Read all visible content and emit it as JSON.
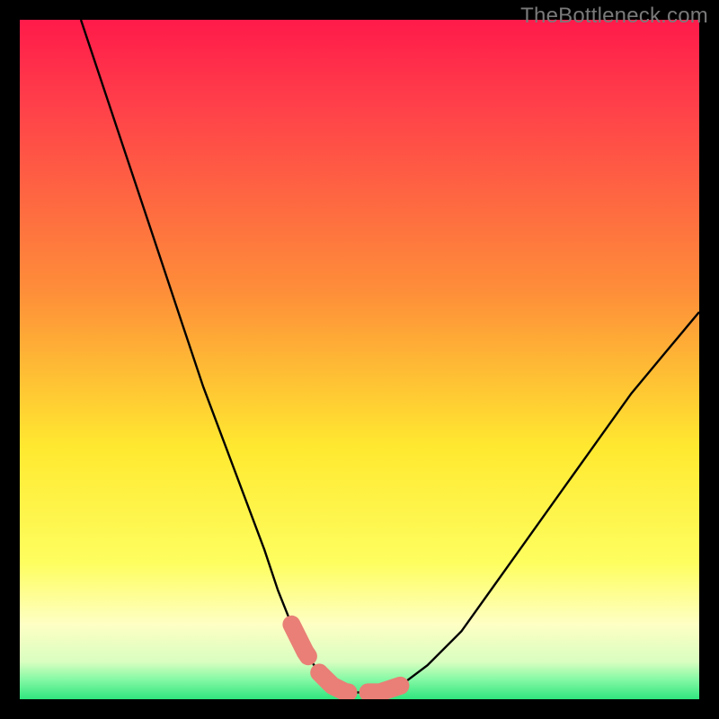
{
  "watermark": "TheBottleneck.com",
  "colors": {
    "frame": "#000000",
    "gradient_top": "#ff1a4a",
    "gradient_mid_orange": "#fe8e39",
    "gradient_mid_yellow": "#ffe930",
    "gradient_pale": "#feffc4",
    "gradient_green": "#2fe57e",
    "curve_stroke": "#000000",
    "highlight": "#e97f76"
  },
  "chart_data": {
    "type": "line",
    "title": "",
    "xlabel": "",
    "ylabel": "",
    "xlim": [
      0,
      100
    ],
    "ylim": [
      0,
      100
    ],
    "series": [
      {
        "name": "bottleneck-curve",
        "x": [
          9,
          12,
          15,
          18,
          21,
          24,
          27,
          30,
          33,
          36,
          38,
          40,
          42,
          44,
          46,
          48,
          50,
          53,
          56,
          60,
          65,
          70,
          75,
          80,
          85,
          90,
          95,
          100
        ],
        "y": [
          100,
          91,
          82,
          73,
          64,
          55,
          46,
          38,
          30,
          22,
          16,
          11,
          7,
          4,
          2,
          1,
          1,
          1,
          2,
          5,
          10,
          17,
          24,
          31,
          38,
          45,
          51,
          57
        ]
      }
    ],
    "highlight_region": {
      "name": "optimal-range",
      "x": [
        40,
        42,
        44,
        46,
        48,
        50,
        53,
        56
      ],
      "y": [
        11,
        7,
        4,
        2,
        1,
        1,
        1,
        2
      ]
    },
    "gradient_stops": [
      {
        "offset": 0.0,
        "color": "#ff1a4a"
      },
      {
        "offset": 0.12,
        "color": "#ff3e4a"
      },
      {
        "offset": 0.4,
        "color": "#fe8e39"
      },
      {
        "offset": 0.63,
        "color": "#ffe930"
      },
      {
        "offset": 0.8,
        "color": "#fefe60"
      },
      {
        "offset": 0.89,
        "color": "#feffc4"
      },
      {
        "offset": 0.945,
        "color": "#d9fec0"
      },
      {
        "offset": 0.97,
        "color": "#88f9a6"
      },
      {
        "offset": 1.0,
        "color": "#2fe57e"
      }
    ]
  }
}
